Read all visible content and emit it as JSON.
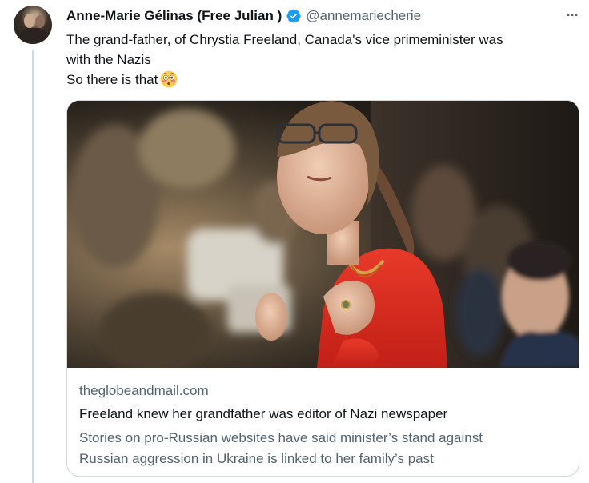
{
  "tweet": {
    "author": {
      "display_name": "Anne-Marie Gélinas (Free Julian )",
      "handle": "@annemariecherie",
      "verified": true
    },
    "text_lines": [
      "The grand-father, of Chrystia Freeland, Canada's vice primeminister was",
      "with the Nazis",
      "So there is that"
    ],
    "emoji": "flushed-face-emoji",
    "more_label": "···"
  },
  "card": {
    "domain": "theglobeandmail.com",
    "title": "Freeland knew her grandfather was editor of Nazi newspaper",
    "description_lines": [
      "Stories on pro-Russian websites have said minister’s stand against",
      "Russian aggression in Ukraine is linked to her family’s past"
    ]
  },
  "colors": {
    "primary_text": "#0f1419",
    "secondary_text": "#536471",
    "border": "#cfd9de",
    "verified_blue": "#1d9bf0"
  }
}
